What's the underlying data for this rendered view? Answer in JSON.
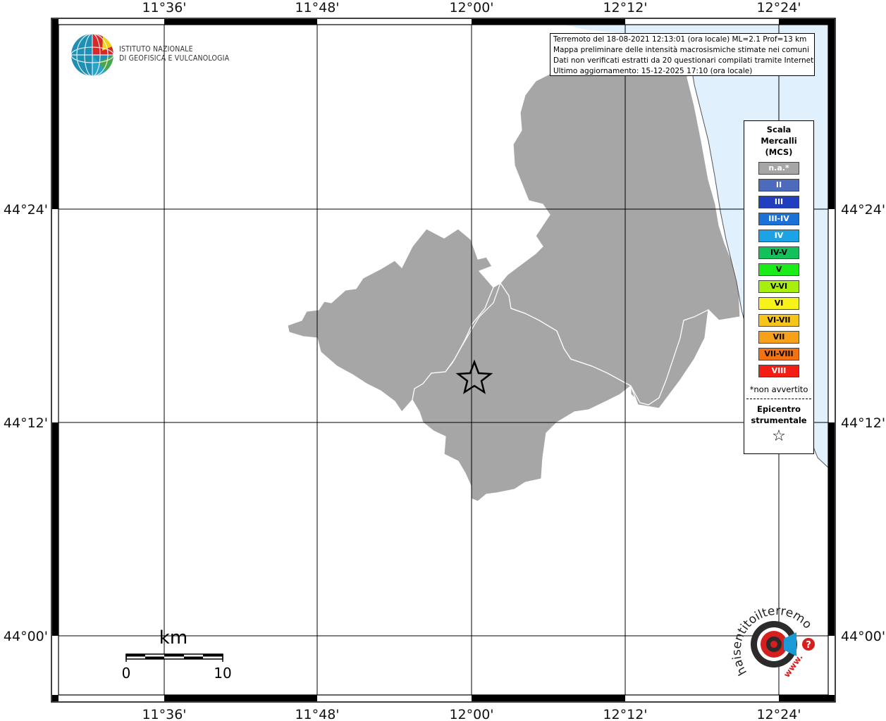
{
  "map": {
    "lon_labels": [
      "11°36'",
      "11°48'",
      "12°00'",
      "12°12'",
      "12°24'"
    ],
    "lat_labels": [
      "44°24'",
      "44°12'",
      "44°00'"
    ],
    "colors": {
      "land": "#a6a6a6",
      "sea": "#e0f0fc",
      "frame": "#000000"
    }
  },
  "logo": {
    "line1": "ISTITUTO NAZIONALE",
    "line2": "DI GEOFISICA E VULCANOLOGIA"
  },
  "info": {
    "line1": "Terremoto del 18-08-2021 12:13:01 (ora locale) ML=2.1 Prof=13 km",
    "line2": "Mappa preliminare delle intensità macrosismiche stimate nei comuni",
    "line3": "Dati non verificati estratti da 20 questionari compilati tramite Internet.",
    "line4": "Ultimo aggiornamento: 15-12-2025 17:10 (ora locale)"
  },
  "legend": {
    "title1": "Scala",
    "title2": "Mercalli",
    "title3": "(MCS)",
    "items": [
      {
        "label": "n.a.*",
        "color": "#a6a6a6",
        "text": "#ffffff"
      },
      {
        "label": "II",
        "color": "#4d6bbd",
        "text": "#ffffff"
      },
      {
        "label": "III",
        "color": "#1f3fbf",
        "text": "#ffffff"
      },
      {
        "label": "III-IV",
        "color": "#1a72d9",
        "text": "#ffffff"
      },
      {
        "label": "IV",
        "color": "#1ca3e6",
        "text": "#ffffff"
      },
      {
        "label": "IV-V",
        "color": "#12c15a",
        "text": "#000000"
      },
      {
        "label": "V",
        "color": "#1aec1a",
        "text": "#000000"
      },
      {
        "label": "V-VI",
        "color": "#a8ee0f",
        "text": "#000000"
      },
      {
        "label": "VI",
        "color": "#f7f21a",
        "text": "#000000"
      },
      {
        "label": "VI-VII",
        "color": "#f7c41a",
        "text": "#000000"
      },
      {
        "label": "VII",
        "color": "#f7a01a",
        "text": "#000000"
      },
      {
        "label": "VII-VIII",
        "color": "#f6720f",
        "text": "#000000"
      },
      {
        "label": "VIII",
        "color": "#f31d14",
        "text": "#ffffff"
      }
    ],
    "note": "*non avvertito",
    "epicenter1": "Epicentro",
    "epicenter2": "strumentale"
  },
  "scalebar": {
    "unit": "km",
    "min": "0",
    "max": "10"
  },
  "badge": {
    "arc_text": "haisentitoilterremoto.it",
    "www": "www.",
    "q": "?"
  }
}
